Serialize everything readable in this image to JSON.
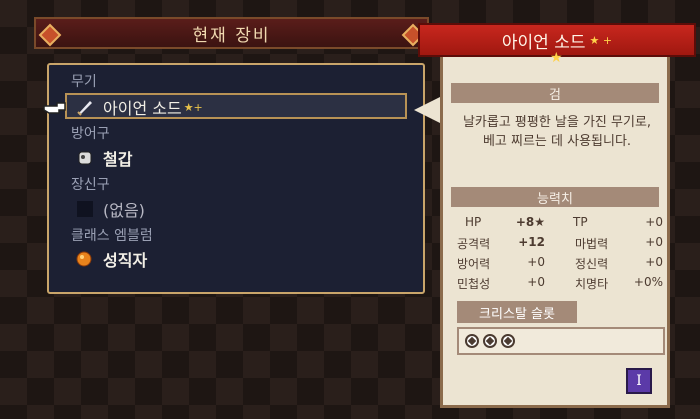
{
  "header": {
    "title": "현재 장비"
  },
  "equipment": {
    "weapon": {
      "category": "무기",
      "name": "아이언 소드",
      "stars": "★+",
      "icon": "sword-icon"
    },
    "armor": {
      "category": "방어구",
      "name": "철갑",
      "icon": "armor-icon"
    },
    "accessory": {
      "category": "장신구",
      "name": "(없음)",
      "icon": "empty-slot-icon"
    },
    "emblem": {
      "category": "클래스 엠블럼",
      "name": "성직자",
      "icon": "emblem-icon"
    }
  },
  "info": {
    "title": "아이언 소드",
    "title_stars": "★ +",
    "type": "검",
    "description": "날카롭고 평평한 날을 가진 무기로, 베고 찌르는 데 사용됩니다.",
    "stats_header": "능력치",
    "stats": [
      {
        "label": "HP",
        "value": "+8★"
      },
      {
        "label": "TP",
        "value": "+0"
      },
      {
        "label": "공격력",
        "value": "+12"
      },
      {
        "label": "마법력",
        "value": "+0"
      },
      {
        "label": "방어력",
        "value": "+0"
      },
      {
        "label": "정신력",
        "value": "+0"
      },
      {
        "label": "민첩성",
        "value": "+0"
      },
      {
        "label": "치명타",
        "value": "+0%"
      }
    ],
    "crystal_header": "크리스탈 슬롯",
    "crystal_slots": 3,
    "info_button": "I"
  },
  "colors": {
    "accent_red": "#c8271e",
    "panel_navy": "#1c2033",
    "parchment": "#ece4d2"
  }
}
